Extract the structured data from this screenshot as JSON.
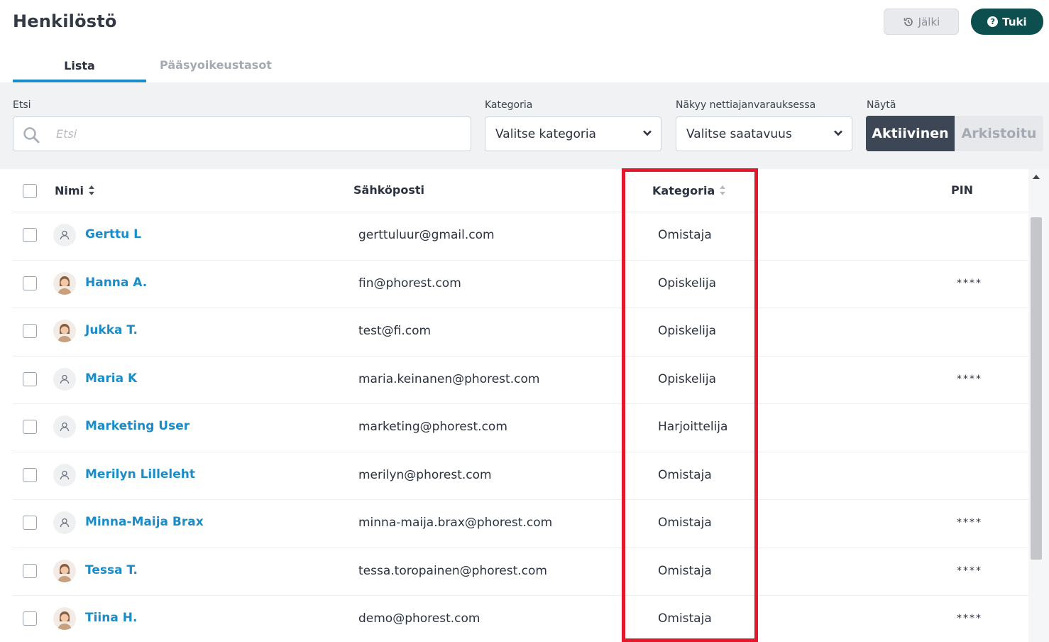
{
  "header": {
    "title": "Henkilöstö",
    "history_label": "Jälki",
    "support_label": "Tuki",
    "support_icon": "?"
  },
  "tabs": [
    {
      "label": "Lista",
      "active": true
    },
    {
      "label": "Pääsyoikeustasot",
      "active": false
    }
  ],
  "filters": {
    "search_label": "Etsi",
    "search_placeholder": "Etsi",
    "search_value": "",
    "category_label": "Kategoria",
    "category_value": "Valitse kategoria",
    "availability_label": "Näkyy nettiajanvarauksessa",
    "availability_value": "Valitse saatavuus",
    "show_label": "Näytä",
    "show_options": [
      "Aktiivinen",
      "Arkistoitu"
    ],
    "show_selected": "Aktiivinen"
  },
  "table": {
    "columns": {
      "name": "Nimi",
      "email": "Sähköposti",
      "category": "Kategoria",
      "pin": "PIN"
    },
    "rows": [
      {
        "name": "Gerttu L",
        "email": "gerttuluur@gmail.com",
        "category": "Omistaja",
        "pin": "",
        "avatar": "placeholder"
      },
      {
        "name": "Hanna A.",
        "email": "fin@phorest.com",
        "category": "Opiskelija",
        "pin": "****",
        "avatar": "photo"
      },
      {
        "name": "Jukka T.",
        "email": "test@fi.com",
        "category": "Opiskelija",
        "pin": "",
        "avatar": "photo"
      },
      {
        "name": "Maria K",
        "email": "maria.keinanen@phorest.com",
        "category": "Opiskelija",
        "pin": "****",
        "avatar": "placeholder"
      },
      {
        "name": "Marketing User",
        "email": "marketing@phorest.com",
        "category": "Harjoittelija",
        "pin": "",
        "avatar": "placeholder"
      },
      {
        "name": "Merilyn Lilleleht",
        "email": "merilyn@phorest.com",
        "category": "Omistaja",
        "pin": "",
        "avatar": "placeholder"
      },
      {
        "name": "Minna-Maija Brax",
        "email": "minna-maija.brax@phorest.com",
        "category": "Omistaja",
        "pin": "****",
        "avatar": "placeholder"
      },
      {
        "name": "Tessa T.",
        "email": "tessa.toropainen@phorest.com",
        "category": "Omistaja",
        "pin": "****",
        "avatar": "photo"
      },
      {
        "name": "Tiina H.",
        "email": "demo@phorest.com",
        "category": "Omistaja",
        "pin": "****",
        "avatar": "photo"
      }
    ]
  },
  "colors": {
    "accent": "#1a8cc7",
    "support_button": "#0d4f4f",
    "active_toggle": "#3d4654",
    "highlight": "#e3192b"
  }
}
